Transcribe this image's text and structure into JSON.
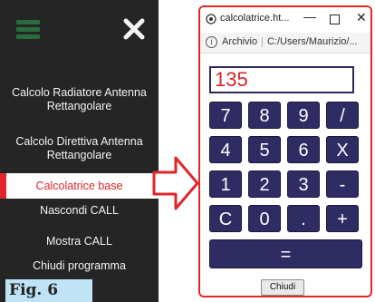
{
  "sidebar": {
    "menu_icon": "hamburger-icon",
    "close_icon": "close-icon",
    "items": [
      {
        "label": "Calcolo Radiatore Antenna\nRettangolare"
      },
      {
        "label": "Calcolo Direttiva Antenna\nRettangolare"
      },
      {
        "label": "Calcolatrice base",
        "active": true
      },
      {
        "label": "Nascondi CALL"
      },
      {
        "label": "Mostra CALL"
      },
      {
        "label": "Chiudi programma"
      }
    ],
    "active_color": "#e1262a",
    "background": "#252525"
  },
  "figure_label": "Fig. 6",
  "window": {
    "title": "calcolatrice.ht...",
    "minimize": "—",
    "close": "✕",
    "address": {
      "label": "Archivio",
      "path": "C:/Users/Maurizio/..."
    },
    "display_value": "135",
    "keys": [
      "7",
      "8",
      "9",
      "/",
      "4",
      "5",
      "6",
      "X",
      "1",
      "2",
      "3",
      "-",
      "C",
      "0",
      ".",
      "+"
    ],
    "equals": "=",
    "close_button": "Chiudi",
    "key_color": "#2f2c64"
  }
}
